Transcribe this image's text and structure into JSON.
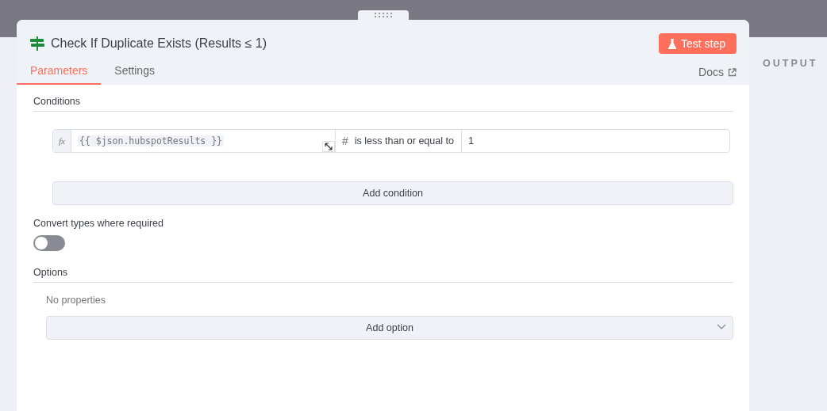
{
  "node": {
    "title": "Check If Duplicate Exists (Results ≤ 1)",
    "test_button": "Test step",
    "docs_link": "Docs"
  },
  "tabs": [
    {
      "label": "Parameters",
      "selected": true
    },
    {
      "label": "Settings",
      "selected": false
    }
  ],
  "conditions": {
    "label": "Conditions",
    "rows": [
      {
        "fx": "fx",
        "left_value": "{{ $json.hubspotResults }}",
        "type_icon": "#",
        "operator": "is less than or equal to",
        "right_value": "1"
      }
    ],
    "add_button": "Add condition"
  },
  "convert_types": {
    "label": "Convert types where required",
    "on": false
  },
  "options": {
    "label": "Options",
    "empty_text": "No properties",
    "add_button": "Add option"
  },
  "output": {
    "label": "OUTPUT"
  }
}
